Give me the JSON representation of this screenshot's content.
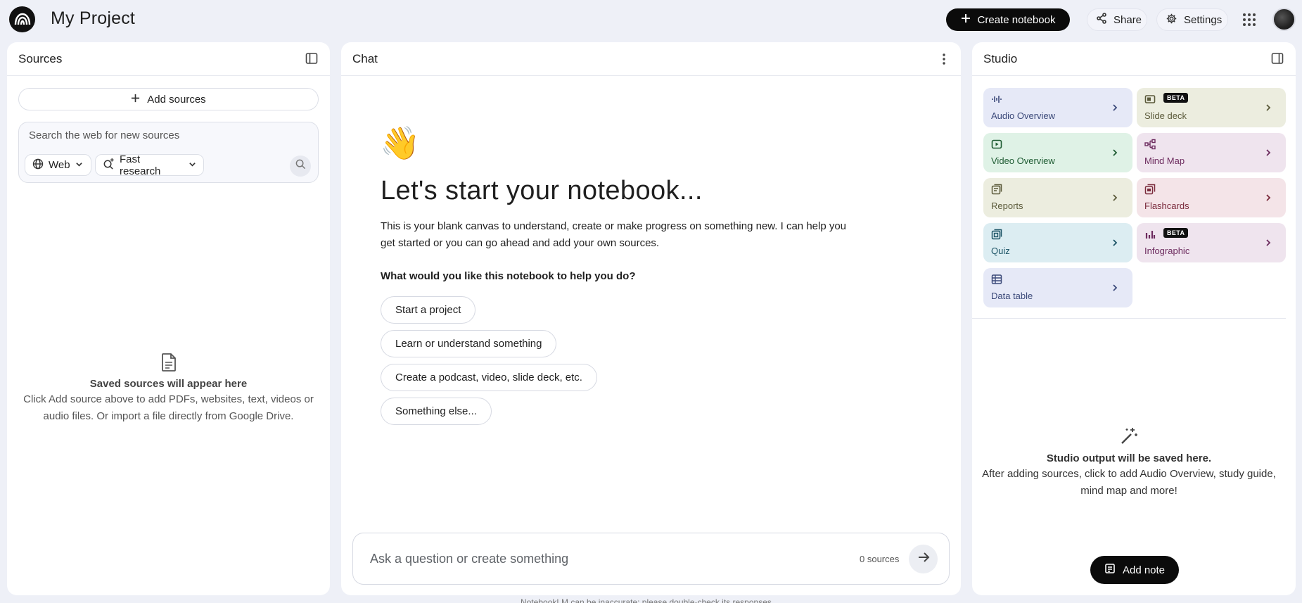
{
  "header": {
    "project_title": "My Project",
    "create_label": "Create notebook",
    "share_label": "Share",
    "settings_label": "Settings"
  },
  "sources": {
    "title": "Sources",
    "add_label": "Add sources",
    "search_placeholder": "Search the web for new sources",
    "web_chip": "Web",
    "research_chip": "Fast research",
    "empty_title": "Saved sources will appear here",
    "empty_desc": "Click Add source above to add PDFs, websites, text, videos or audio files. Or import a file directly from Google Drive."
  },
  "chat": {
    "title": "Chat",
    "emoji": "👋",
    "heading": "Let's start your notebook...",
    "intro": "This is your blank canvas to understand, create or make progress on something new. I can help you get started or you can go ahead and add your own sources.",
    "question": "What would you like this notebook to help you do?",
    "suggestions": [
      "Start a project",
      "Learn or understand something",
      "Create a podcast, video, slide deck, etc.",
      "Something else..."
    ],
    "input_placeholder": "Ask a question or create something",
    "source_count": "0 sources",
    "disclaimer": "NotebookLM can be inaccurate; please double-check its responses."
  },
  "studio": {
    "title": "Studio",
    "beta_label": "BETA",
    "tiles": [
      {
        "label": "Audio Overview",
        "icon": "audio-wave-icon",
        "bg": "#e6e9f7",
        "fg": "#3c4a7a"
      },
      {
        "label": "Slide deck",
        "icon": "slides-icon",
        "bg": "#eceddf",
        "fg": "#5b5a3a"
      },
      {
        "label": "Video Overview",
        "icon": "video-icon",
        "bg": "#dff2e6",
        "fg": "#1f5c33"
      },
      {
        "label": "Mind Map",
        "icon": "mind-map-icon",
        "bg": "#efe4ee",
        "fg": "#6d2c5f"
      },
      {
        "label": "Reports",
        "icon": "reports-icon",
        "bg": "#eceddf",
        "fg": "#5b5a3a"
      },
      {
        "label": "Flashcards",
        "icon": "flashcards-icon",
        "bg": "#f4e4e8",
        "fg": "#7a2a3c"
      },
      {
        "label": "Quiz",
        "icon": "quiz-icon",
        "bg": "#dcedf2",
        "fg": "#1d5466"
      },
      {
        "label": "Infographic",
        "icon": "infographic-icon",
        "bg": "#efe4ee",
        "fg": "#6d2c5f"
      },
      {
        "label": "Data table",
        "icon": "data-table-icon",
        "bg": "#e6e9f7",
        "fg": "#3c4a7a"
      }
    ],
    "empty_title": "Studio output will be saved here.",
    "empty_desc": "After adding sources, click to add Audio Overview, study guide, mind map and more!",
    "add_note_label": "Add note"
  }
}
